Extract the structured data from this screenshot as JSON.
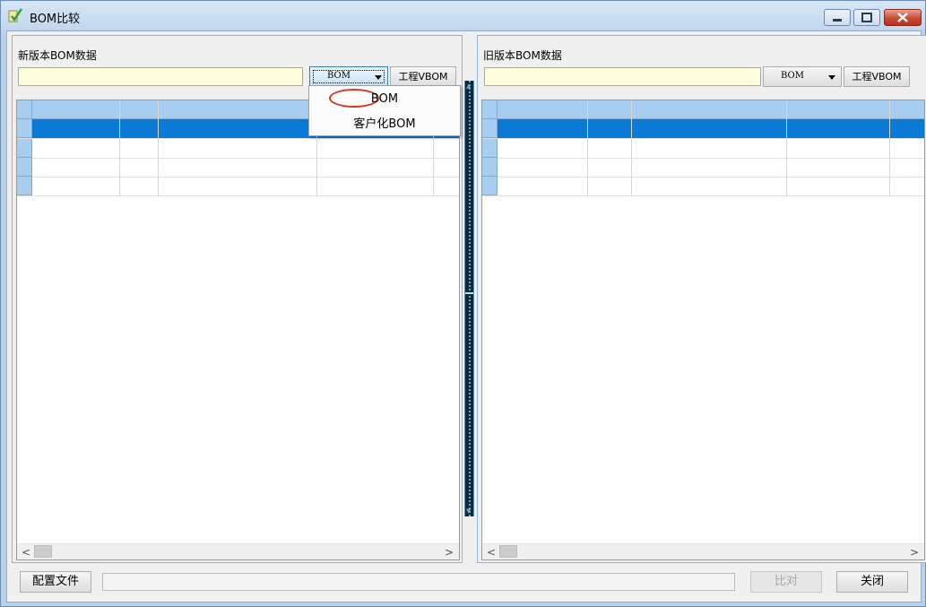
{
  "window": {
    "title": "BOM比较"
  },
  "left_pane": {
    "label": "新版本BOM数据",
    "path_value": "",
    "combo_value": "BOM",
    "engineering_button": "工程VBOM"
  },
  "right_pane": {
    "label": "旧版本BOM数据",
    "path_value": "",
    "combo_value": "BOM",
    "engineering_button": "工程VBOM"
  },
  "dropdown": {
    "options": [
      "BOM",
      "客户化BOM"
    ],
    "selected": "BOM"
  },
  "bottom": {
    "config_button": "配置文件",
    "compare_button": "比对",
    "close_button": "关闭"
  },
  "scrollbar": {
    "left_arrow": "<",
    "right_arrow": ">"
  },
  "colors": {
    "selection": "#0a7ad6",
    "header": "#a7cdf0",
    "input_bg": "#ffffdc",
    "highlight_circle": "#d23a28"
  }
}
